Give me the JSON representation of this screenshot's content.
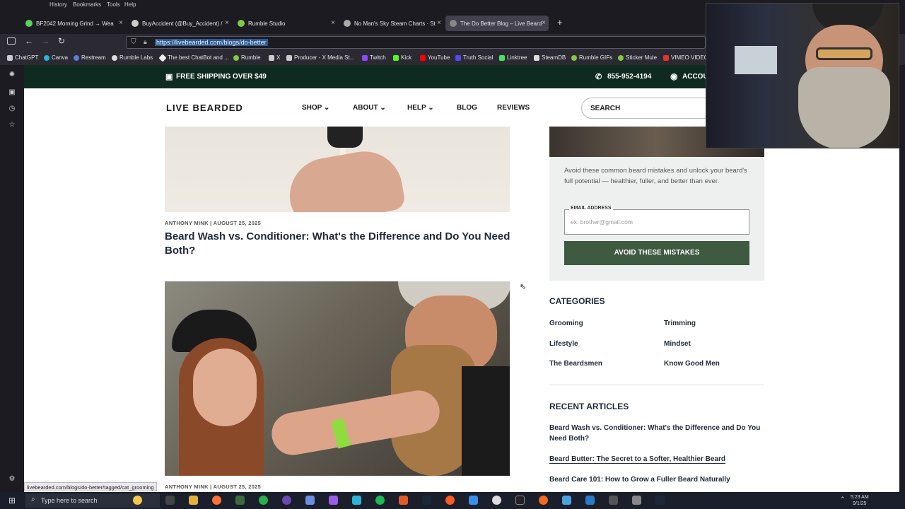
{
  "menubar": [
    "History",
    "Bookmarks",
    "Tools",
    "Help"
  ],
  "tabs": [
    {
      "label": "BF2042 Morning Grind → Wea",
      "color": "#5bd35b"
    },
    {
      "label": "BuyAccident (@Buy_Accident) /",
      "color": "#cccccc"
    },
    {
      "label": "Rumble Studio",
      "color": "#85c742"
    },
    {
      "label": "No Man's Sky Steam Charts · St",
      "color": "#aaaaaa"
    },
    {
      "label": "The Do Better Blog – Live Beard",
      "color": "#888888"
    }
  ],
  "url": "https://livebearded.com/blogs/do-better",
  "bookmarks": [
    "ChatGPT",
    "Canva",
    "Restream",
    "Rumble Labs",
    "The best ChatBot and ...",
    "Rumble",
    "X",
    "Producer - X Media St...",
    "Twitch",
    "Kick",
    "YouTube",
    "Truth Social",
    "Linktree",
    "SteamDB",
    "Rumble GIFs",
    "Sticker Mule",
    "VIMEO VIDEO"
  ],
  "promo": {
    "shipping": "FREE SHIPPING OVER $49",
    "phone": "855-952-4194",
    "account": "ACCOU"
  },
  "header": {
    "logo": "LIVE BEARDED",
    "nav": [
      "SHOP",
      "ABOUT",
      "HELP",
      "BLOG",
      "REVIEWS"
    ],
    "search": "SEARCH"
  },
  "posts": [
    {
      "meta": "ANTHONY MINK | AUGUST 25, 2025",
      "title": "Beard Wash vs. Conditioner: What's the Difference and Do You Need Both?"
    },
    {
      "meta": "ANTHONY MINK | AUGUST 25, 2025"
    }
  ],
  "signup": {
    "text": "Avoid these common beard mistakes and unlock your beard's full potential — healthier, fuller, and better than ever.",
    "email_label": "EMAIL ADDRESS",
    "email_placeholder": "ex: brother@gmail.com",
    "button": "AVOID THESE MISTAKES"
  },
  "categories": {
    "heading": "CATEGORIES",
    "items": [
      "Grooming",
      "Trimming",
      "Lifestyle",
      "Mindset",
      "The Beardsmen",
      "Know Good Men"
    ]
  },
  "recent": {
    "heading": "RECENT ARTICLES",
    "items": [
      "Beard Wash vs. Conditioner: What's the Difference and Do You Need Both?",
      "Beard Butter: The Secret to a Softer, Healthier Beard",
      "Beard Care 101: How to Grow a Fuller Beard Naturally"
    ]
  },
  "status_link": "livebearded.com/blogs/do-better/tagged/cat_grooming",
  "taskbar": {
    "search": "Type here to search",
    "time": "5:23 AM",
    "date": "9/1/25"
  },
  "colors": {
    "promo_bg": "#0f2a20",
    "button_bg": "#3e5a40",
    "title": "#1e2a3a"
  }
}
